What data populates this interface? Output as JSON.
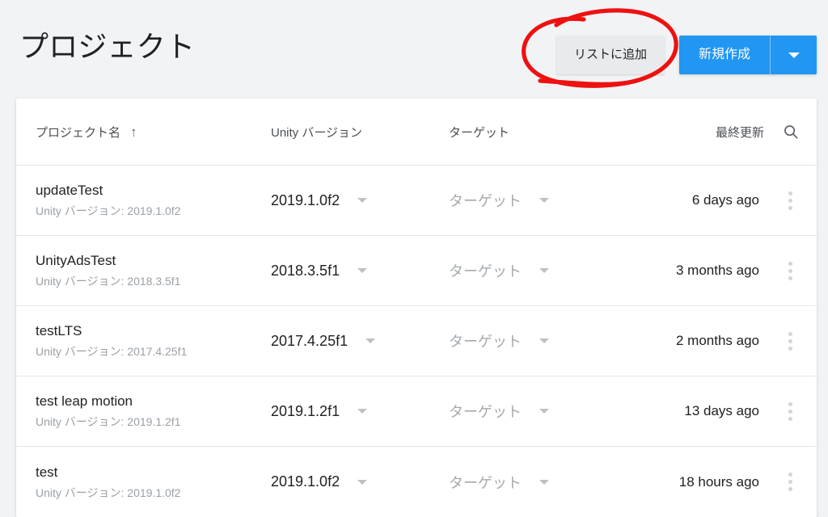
{
  "header": {
    "title": "プロジェクト",
    "add_to_list_label": "リストに追加",
    "create_new_label": "新規作成",
    "create_new_dropdown_icon": "chevron-down-icon"
  },
  "table": {
    "columns": {
      "name": "プロジェクト名",
      "name_sort_icon": "↑",
      "unity_version": "Unity バージョン",
      "target": "ターゲット",
      "last_updated": "最終更新",
      "search_icon": "search-icon"
    },
    "rows": [
      {
        "name": "updateTest",
        "subtitle": "Unity バージョン: 2019.1.0f2",
        "version": "2019.1.0f2",
        "target": "ターゲット",
        "updated": "6 days ago",
        "menu_icon": "more-vert-icon"
      },
      {
        "name": "UnityAdsTest",
        "subtitle": "Unity バージョン: 2018.3.5f1",
        "version": "2018.3.5f1",
        "target": "ターゲット",
        "updated": "3 months ago",
        "menu_icon": "more-vert-icon"
      },
      {
        "name": "testLTS",
        "subtitle": "Unity バージョン: 2017.4.25f1",
        "version": "2017.4.25f1",
        "target": "ターゲット",
        "updated": "2 months ago",
        "menu_icon": "more-vert-icon"
      },
      {
        "name": "test leap motion",
        "subtitle": "Unity バージョン: 2019.1.2f1",
        "version": "2019.1.2f1",
        "target": "ターゲット",
        "updated": "13 days ago",
        "menu_icon": "more-vert-icon"
      },
      {
        "name": "test",
        "subtitle": "Unity バージョン: 2019.1.0f2",
        "version": "2019.1.0f2",
        "target": "ターゲット",
        "updated": "18 hours ago",
        "menu_icon": "more-vert-icon"
      }
    ]
  },
  "annotation": {
    "shape": "hand-drawn-red-ellipse",
    "color": "#ee1111",
    "targets": "add-to-list-button"
  },
  "colors": {
    "page_background": "#f1f3f4",
    "card_background": "#ffffff",
    "primary_button": "#2196f3",
    "secondary_button": "#e8eaed",
    "text_primary": "#202124",
    "text_muted": "#9aa0a6",
    "annotation_red": "#ee1111"
  }
}
